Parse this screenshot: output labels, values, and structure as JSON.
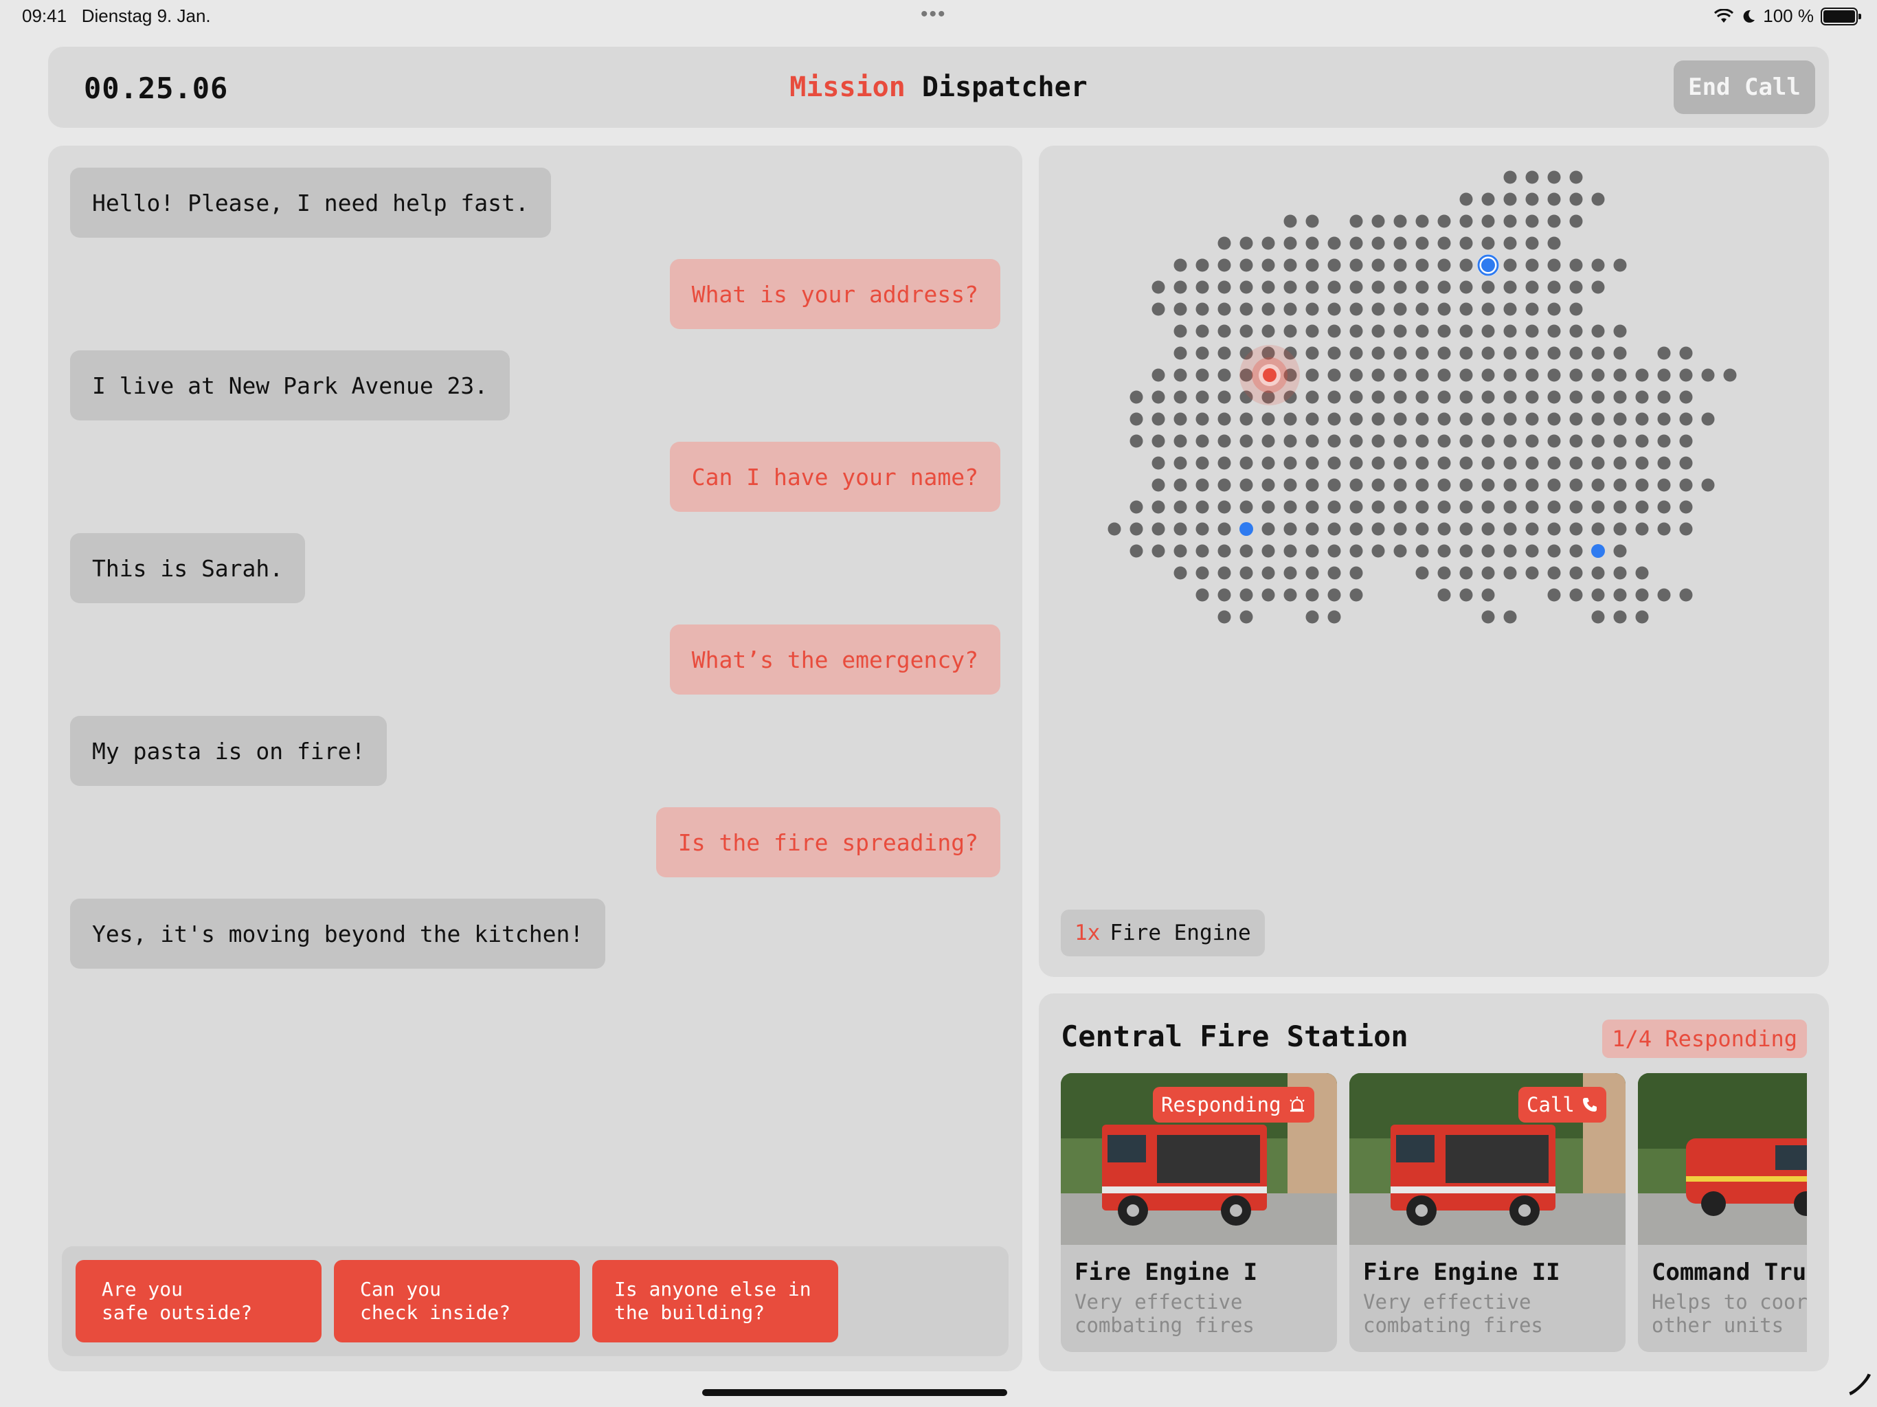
{
  "status_bar": {
    "time": "09:41",
    "date": "Dienstag 9. Jan.",
    "dots": "•••",
    "battery": "100 %"
  },
  "header": {
    "timer": "00.25.06",
    "title_accent": "Mission",
    "title_rest": "Dispatcher",
    "end_call_label": "End Call"
  },
  "chat": {
    "messages": [
      {
        "from": "caller",
        "text": "Hello! Please, I need help fast."
      },
      {
        "from": "dispatcher",
        "text": "What is your address?"
      },
      {
        "from": "caller",
        "text": "I live at New Park Avenue 23."
      },
      {
        "from": "dispatcher",
        "text": "Can I have your name?"
      },
      {
        "from": "caller",
        "text": "This is Sarah."
      },
      {
        "from": "dispatcher",
        "text": "What’s the emergency?"
      },
      {
        "from": "caller",
        "text": "My pasta is on fire!"
      },
      {
        "from": "dispatcher",
        "text": "Is the fire spreading?"
      },
      {
        "from": "caller",
        "text": "Yes, it's moving beyond the kitchen!"
      }
    ],
    "quick_replies": [
      "Are you\nsafe outside?",
      "Can you\ncheck inside?",
      "Is anyone else in\nthe building?"
    ]
  },
  "map": {
    "unit_count": "1x",
    "unit_label": "Fire Engine"
  },
  "station": {
    "title": "Central Fire Station",
    "badge": "1/4 Responding",
    "units": [
      {
        "name": "Fire Engine I",
        "desc": "Very effective\ncombating fires",
        "tag": "Responding",
        "tag_icon": "siren-icon"
      },
      {
        "name": "Fire Engine II",
        "desc": "Very effective\ncombating fires",
        "tag": "Call",
        "tag_icon": "phone-icon"
      },
      {
        "name": "Command Truck",
        "desc": "Helps to coordinate\nother units",
        "tag": "",
        "tag_icon": ""
      }
    ]
  },
  "colors": {
    "accent": "#e84c3d",
    "unit_blue": "#2f7bf0",
    "dot": "#666666"
  }
}
